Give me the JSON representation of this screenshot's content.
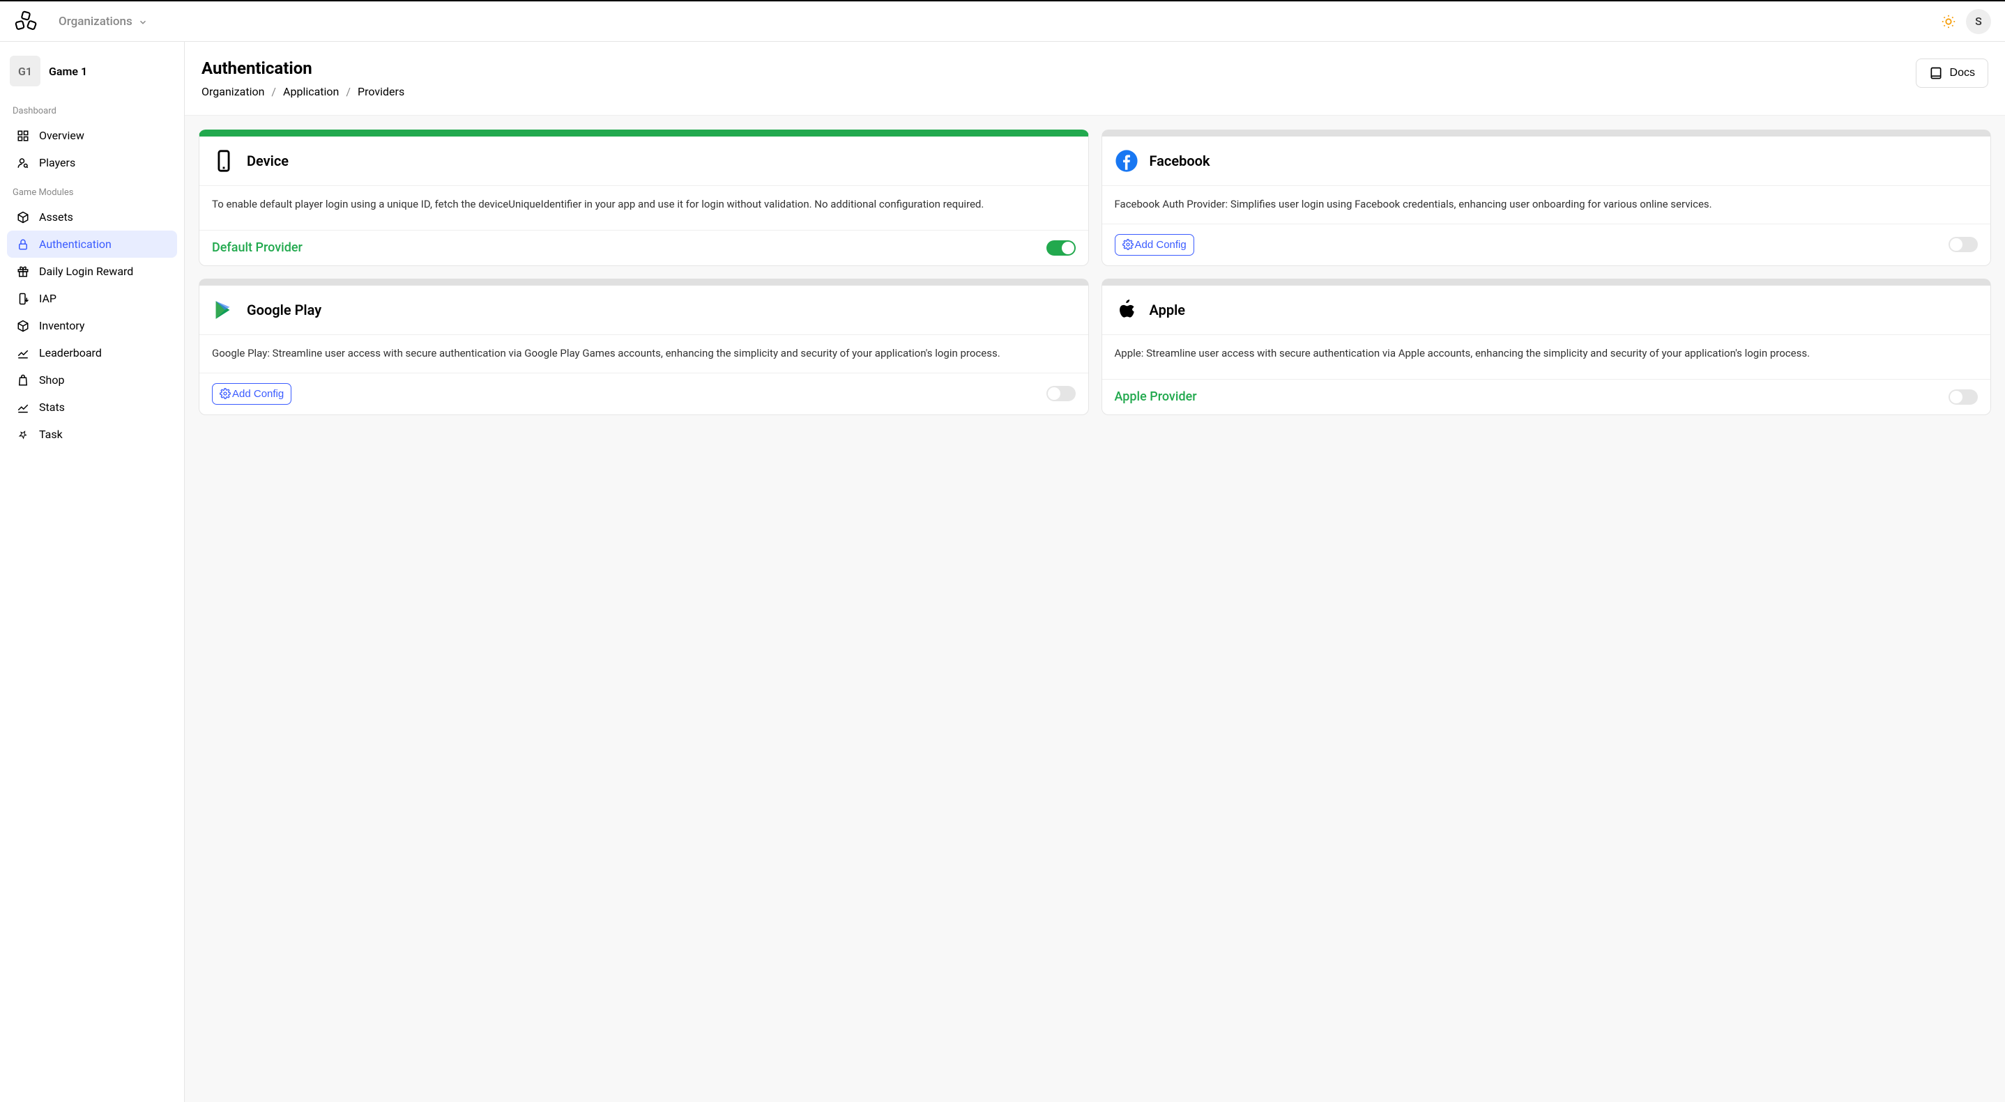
{
  "header": {
    "org_label": "Organizations",
    "avatar_initial": "S"
  },
  "sidebar": {
    "game_badge": "G1",
    "game_name": "Game 1",
    "group1_label": "Dashboard",
    "items1": {
      "overview": "Overview",
      "players": "Players"
    },
    "group2_label": "Game Modules",
    "items2": {
      "assets": "Assets",
      "authentication": "Authentication",
      "daily_login_reward": "Daily Login Reward",
      "iap": "IAP",
      "inventory": "Inventory",
      "leaderboard": "Leaderboard",
      "shop": "Shop",
      "stats": "Stats",
      "task": "Task"
    }
  },
  "page": {
    "title": "Authentication",
    "breadcrumb": {
      "organization": "Organization",
      "application": "Application",
      "providers": "Providers"
    },
    "docs_button": "Docs"
  },
  "providers": {
    "device": {
      "title": "Device",
      "description": "To enable default player login using a unique ID, fetch the deviceUniqueIdentifier in your app and use it for login without validation. No additional configuration required.",
      "footer_label": "Default Provider",
      "toggle_on": true
    },
    "facebook": {
      "title": "Facebook",
      "description": "Facebook Auth Provider: Simplifies user login using Facebook credentials, enhancing user onboarding for various online services.",
      "add_config_label": "Add Config",
      "toggle_on": false
    },
    "google_play": {
      "title": "Google Play",
      "description": "Google Play: Streamline user access with secure authentication via Google Play Games accounts, enhancing the simplicity and security of your application's login process.",
      "add_config_label": "Add Config",
      "toggle_on": false
    },
    "apple": {
      "title": "Apple",
      "description": "Apple: Streamline user access with secure authentication via Apple accounts, enhancing the simplicity and security of your application's login process.",
      "footer_label": "Apple Provider",
      "toggle_on": false
    }
  }
}
